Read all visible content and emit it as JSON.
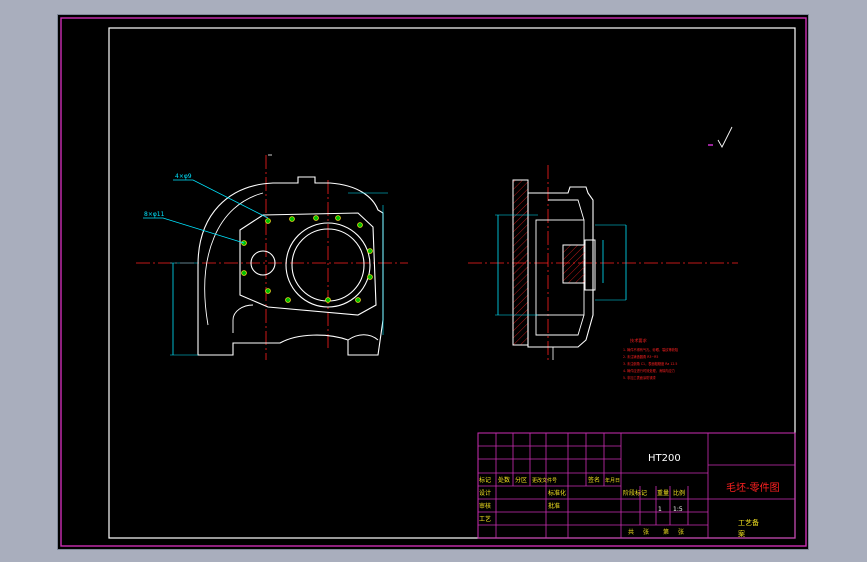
{
  "colors": {
    "background": "#a9aebd",
    "viewport": "#000000",
    "frame": "#cc2eb4",
    "geometry": "#ffffff",
    "centerline": "#ff2020",
    "dimension": "#00e5ff",
    "hole": "#f0e020",
    "hole_fill": "#00c000",
    "hatch": "#ff2020"
  },
  "title_block": {
    "material": "HT200",
    "drawing_title": "毛坯-零件图",
    "company": "工艺备",
    "suffix": "案",
    "scale": "1:5",
    "sheet_count": "1",
    "headers": {
      "mark": "标记",
      "count": "处数",
      "zone": "分区",
      "change_doc": "更改文件号",
      "signature": "签名",
      "date": "年月日",
      "designer": "设计",
      "standardize": "标准化",
      "stage_mark": "阶段标记",
      "weight": "重量",
      "ratio": "比例",
      "reviewer": "审核",
      "process": "工艺",
      "approve": "批准",
      "total": "共",
      "sheets": "张",
      "page": "第",
      "page_unit": "张"
    }
  },
  "notes": {
    "heading": "技术要求",
    "lines": [
      "1. 铸件不得有气孔、砂眼、裂纹等缺陷",
      "2. 未注铸造圆角 R3~R5",
      "3. 未注倒角 C1，表面粗糙度 Ra 12.5",
      "4. 铸件应进行时效处理，消除内应力",
      "5. 非加工表面涂防锈漆"
    ]
  },
  "callouts": {
    "front_top": "4×φ9",
    "front_left": "8×φ11"
  }
}
